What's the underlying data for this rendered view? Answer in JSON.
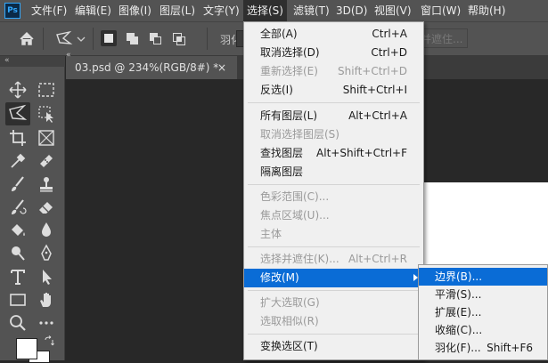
{
  "menubar": {
    "logo": "Ps",
    "items": [
      "文件(F)",
      "编辑(E)",
      "图像(I)",
      "图层(L)",
      "文字(Y)",
      "选择(S)",
      "滤镜(T)",
      "3D(D)",
      "视图(V)",
      "窗口(W)",
      "帮助(H)"
    ],
    "active_index": 5
  },
  "options": {
    "feather_label": "羽化:",
    "mask_button": "择并遮住..."
  },
  "toolbar": {
    "collapse": "«",
    "tools": [
      "move-tool",
      "rectangular-marquee-tool",
      "polygonal-lasso-tool",
      "object-selection-tool",
      "crop-tool",
      "frame-tool",
      "eyedropper-tool",
      "spot-healing-tool",
      "brush-tool",
      "clone-stamp-tool",
      "history-brush-tool",
      "eraser-tool",
      "paint-bucket-tool",
      "blur-tool",
      "dodge-tool",
      "pen-tool",
      "type-tool",
      "path-selection-tool",
      "rectangle-tool",
      "hand-tool",
      "zoom-tool",
      "more-tools"
    ]
  },
  "document": {
    "tab_title": "03.psd @ 234%(RGB/8#) *",
    "close": "×",
    "collapse": "«"
  },
  "select_menu": {
    "items": [
      {
        "label": "全部(A)",
        "shortcut": "Ctrl+A",
        "disabled": false
      },
      {
        "label": "取消选择(D)",
        "shortcut": "Ctrl+D",
        "disabled": false
      },
      {
        "label": "重新选择(E)",
        "shortcut": "Shift+Ctrl+D",
        "disabled": true
      },
      {
        "label": "反选(I)",
        "shortcut": "Shift+Ctrl+I",
        "disabled": false
      },
      {
        "label": "所有图层(L)",
        "shortcut": "Alt+Ctrl+A",
        "disabled": false
      },
      {
        "label": "取消选择图层(S)",
        "shortcut": "",
        "disabled": true
      },
      {
        "label": "查找图层",
        "shortcut": "Alt+Shift+Ctrl+F",
        "disabled": false
      },
      {
        "label": "隔离图层",
        "shortcut": "",
        "disabled": false
      },
      {
        "label": "色彩范围(C)...",
        "shortcut": "",
        "disabled": true
      },
      {
        "label": "焦点区域(U)...",
        "shortcut": "",
        "disabled": true
      },
      {
        "label": "主体",
        "shortcut": "",
        "disabled": true
      },
      {
        "label": "选择并遮住(K)...",
        "shortcut": "Alt+Ctrl+R",
        "disabled": true
      },
      {
        "label": "修改(M)",
        "shortcut": "",
        "disabled": false
      },
      {
        "label": "扩大选取(G)",
        "shortcut": "",
        "disabled": true
      },
      {
        "label": "选取相似(R)",
        "shortcut": "",
        "disabled": true
      },
      {
        "label": "变换选区(T)",
        "shortcut": "",
        "disabled": false
      }
    ]
  },
  "modify_submenu": {
    "items": [
      {
        "label": "边界(B)...",
        "shortcut": ""
      },
      {
        "label": "平滑(S)...",
        "shortcut": ""
      },
      {
        "label": "扩展(E)...",
        "shortcut": ""
      },
      {
        "label": "收缩(C)...",
        "shortcut": ""
      },
      {
        "label": "羽化(F)...",
        "shortcut": "Shift+F6"
      }
    ]
  },
  "colors": {
    "highlight": "#0a6cd6",
    "menu_bg": "#f0f0f0",
    "ui_bg": "#535353",
    "canvas_bg": "#282828"
  }
}
